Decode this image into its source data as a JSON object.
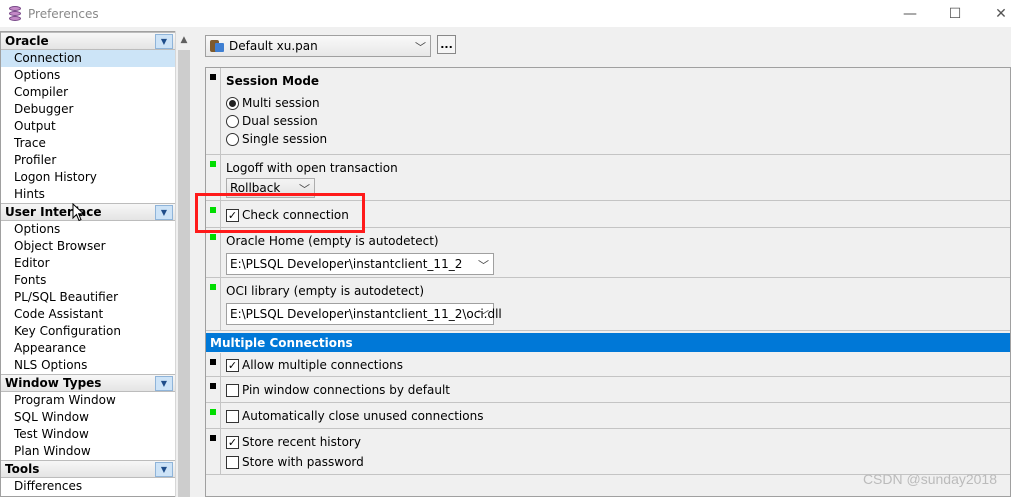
{
  "window": {
    "title": "Preferences",
    "minimize": "—",
    "maximize": "☐",
    "close": "✕"
  },
  "nav": {
    "groups": [
      {
        "label": "Oracle",
        "items": [
          "Connection",
          "Options",
          "Compiler",
          "Debugger",
          "Output",
          "Trace",
          "Profiler",
          "Logon History",
          "Hints"
        ]
      },
      {
        "label": "User Interface",
        "items": [
          "Options",
          "Object Browser",
          "Editor",
          "Fonts",
          "PL/SQL Beautifier",
          "Code Assistant",
          "Key Configuration",
          "Appearance",
          "NLS Options"
        ]
      },
      {
        "label": "Window Types",
        "items": [
          "Program Window",
          "SQL Window",
          "Test Window",
          "Plan Window"
        ]
      },
      {
        "label": "Tools",
        "items": [
          "Differences"
        ]
      }
    ],
    "selected": "Connection"
  },
  "profile": {
    "selected": "Default xu.pan",
    "more_button": "..."
  },
  "session_mode": {
    "title": "Session Mode",
    "options": [
      "Multi session",
      "Dual session",
      "Single session"
    ],
    "selected": "Multi session"
  },
  "logoff": {
    "label": "Logoff with open transaction",
    "value": "Rollback"
  },
  "check_connection": {
    "label": "Check connection",
    "checked": true
  },
  "oracle_home": {
    "label": "Oracle Home (empty is autodetect)",
    "value": "E:\\PLSQL Developer\\instantclient_11_2"
  },
  "oci_library": {
    "label": "OCI library (empty is autodetect)",
    "value": "E:\\PLSQL Developer\\instantclient_11_2\\oci.dll"
  },
  "multiple_connections": {
    "title": "Multiple Connections",
    "allow_multiple": {
      "label": "Allow multiple connections",
      "checked": true
    },
    "pin_window": {
      "label": "Pin window connections by default",
      "checked": false
    },
    "auto_close": {
      "label": "Automatically close unused connections",
      "checked": false
    },
    "store_history": {
      "label": "Store recent history",
      "checked": true
    },
    "store_password": {
      "label": "Store with password",
      "checked": false
    }
  },
  "watermark": "CSDN @sunday2018",
  "colors": {
    "selection_bg": "#cce4f7",
    "banner_bg": "#0078d7",
    "highlight_border": "#ff1a1a",
    "marker_green": "#00dd00",
    "marker_black": "#000000"
  }
}
